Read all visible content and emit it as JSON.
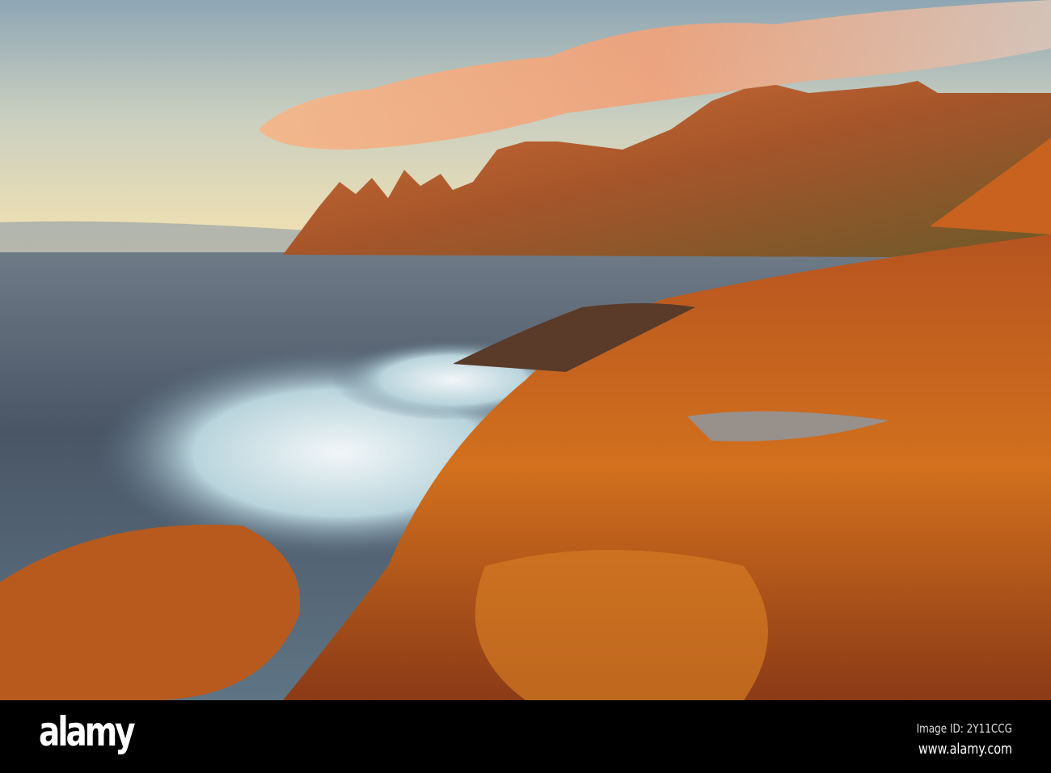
{
  "photo": {
    "subject": "Coastal rocks and jagged mountains at sunset"
  },
  "watermark": {
    "brand": "alamy"
  },
  "footer": {
    "logo": "alamy",
    "image_id": "Image ID: 2Y11CCG",
    "website": "www.alamy.com"
  },
  "colors": {
    "sky_top": "#8ea6b4",
    "sky_horizon": "#f4e2b2",
    "sea": "#4b5868",
    "rock": "#c8601c",
    "cloud": "#f3a878"
  }
}
